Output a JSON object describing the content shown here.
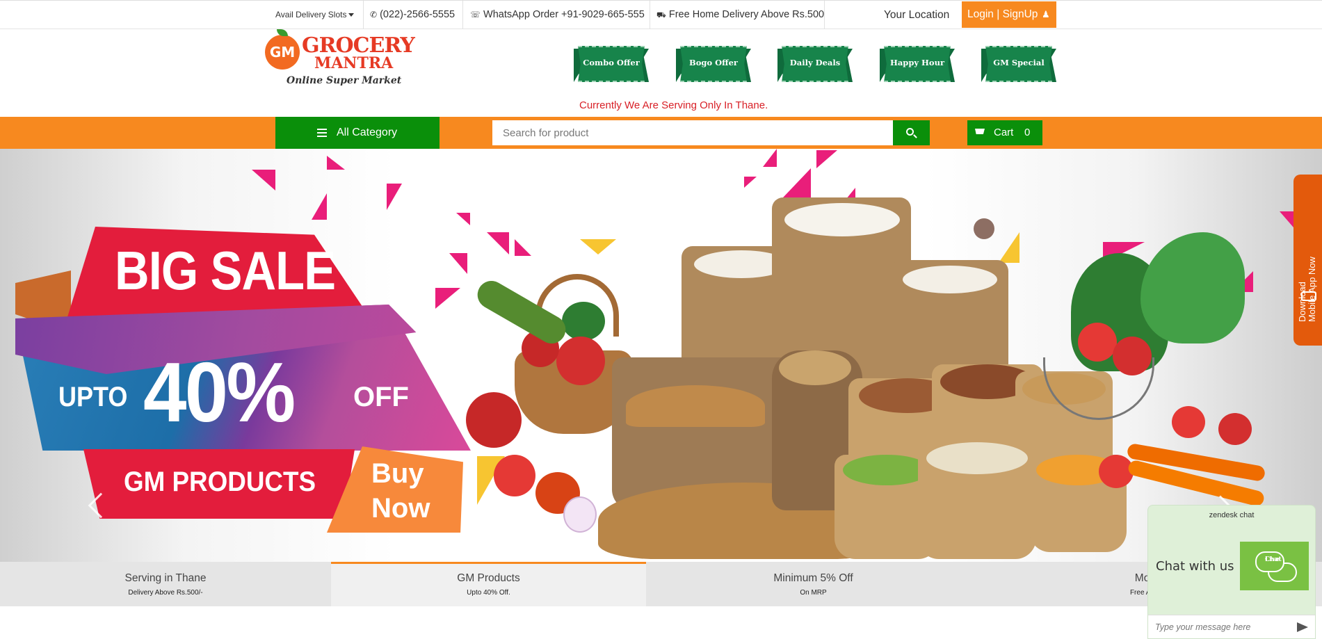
{
  "topbar": {
    "delivery_slots": "Avail Delivery Slots",
    "phone": "(022)-2566-5555",
    "whatsapp": "WhatsApp Order +91-9029-665-555",
    "free_delivery": "Free Home Delivery Above Rs.500",
    "location": "Your Location",
    "login": "Login | SignUp"
  },
  "logo": {
    "gm": "GM",
    "grocery": "GROCERY",
    "mantra": "MANTRA",
    "tagline": "Online Super Market"
  },
  "offers": [
    "Combo Offer",
    "Bogo Offer",
    "Daily Deals",
    "Happy Hour",
    "GM Special"
  ],
  "notice": "Currently We Are Serving Only In Thane.",
  "nav": {
    "all_category": "All Category",
    "search_placeholder": "Search for product",
    "cart_label": "Cart",
    "cart_count": "0"
  },
  "banner": {
    "headline": "BIG SALE",
    "upto": "UPTO",
    "discount": "40%",
    "off": "OFF",
    "products": "GM PRODUCTS",
    "cta_line1": "Buy",
    "cta_line2": "Now"
  },
  "features": [
    {
      "title": "Serving in Thane",
      "sub": "Delivery Above Rs.500/-"
    },
    {
      "title": "GM Products",
      "sub": "Upto 40% Off."
    },
    {
      "title": "Minimum 5% Off",
      "sub": "On MRP"
    },
    {
      "title": "Mornin",
      "sub": "Free Amul Mil"
    }
  ],
  "download_tab": {
    "line1": "Download",
    "line2": "Mobile App Now"
  },
  "chat": {
    "brand": "zendesk chat",
    "label": "Chat with us",
    "button_line1": "Live",
    "button_line2": "Chat",
    "input_placeholder": "Type your message here"
  },
  "colors": {
    "orange": "#f7891f",
    "green": "#0a8f0a",
    "ribbon_green": "#17844b",
    "notice_red": "#d81f26",
    "tab_orange": "#e35a0c"
  }
}
